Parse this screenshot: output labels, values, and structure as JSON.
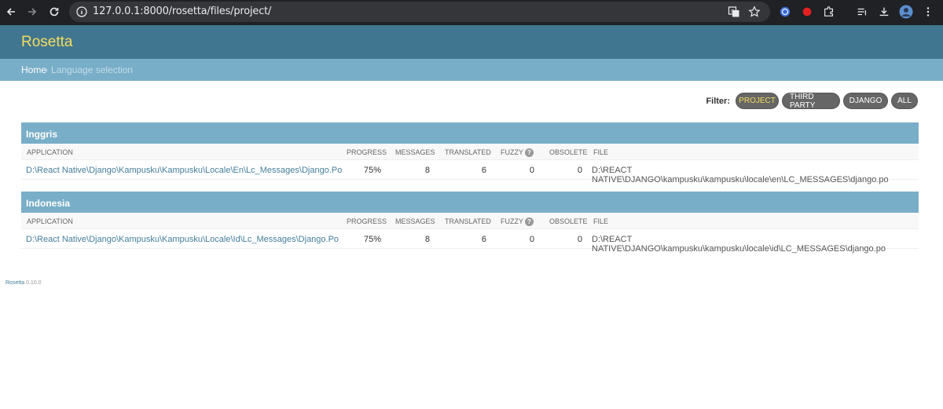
{
  "browser": {
    "url": "127.0.0.1:8000/rosetta/files/project/"
  },
  "header": {
    "title": "Rosetta"
  },
  "breadcrumbs": {
    "home": "Home",
    "separator": "›",
    "current": "Language selection"
  },
  "filter": {
    "label": "Filter:",
    "options": [
      "PROJECT",
      "THIRD PARTY",
      "DJANGO",
      "ALL"
    ],
    "active": "PROJECT"
  },
  "columns": {
    "application": "APPLICATION",
    "progress": "PROGRESS",
    "messages": "MESSAGES",
    "translated": "TRANSLATED",
    "fuzzy": "FUZZY",
    "fuzzy_help": "?",
    "obsolete": "OBSOLETE",
    "file": "FILE"
  },
  "languages": [
    {
      "name": "Inggris",
      "rows": [
        {
          "application": "D:\\React Native\\Django\\Kampusku\\Kampusku\\Locale\\En\\Lc_Messages\\Django.Po",
          "progress": "75%",
          "messages": "8",
          "translated": "6",
          "fuzzy": "0",
          "obsolete": "0",
          "file": "D:\\REACT NATIVE\\DJANGO\\kampusku\\kampusku\\locale\\en\\LC_MESSAGES\\django.po"
        }
      ]
    },
    {
      "name": "Indonesia",
      "rows": [
        {
          "application": "D:\\React Native\\Django\\Kampusku\\Kampusku\\Locale\\Id\\Lc_Messages\\Django.Po",
          "progress": "75%",
          "messages": "8",
          "translated": "6",
          "fuzzy": "0",
          "obsolete": "0",
          "file": "D:\\REACT NATIVE\\DJANGO\\kampusku\\kampusku\\locale\\id\\LC_MESSAGES\\django.po"
        }
      ]
    }
  ],
  "footer": {
    "name": "Rosetta",
    "version": "0.10.0"
  },
  "colors": {
    "header": "#417690",
    "breadcrumbs": "#79aec8",
    "title": "#f5dd5d",
    "link": "#447e9b"
  }
}
